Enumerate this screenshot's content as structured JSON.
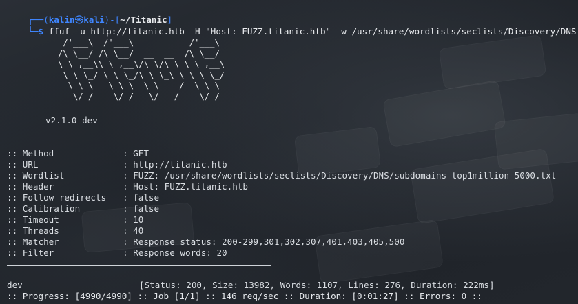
{
  "prompt": {
    "open": "┌──(",
    "user": "kalin",
    "at": "㉿",
    "host": "kali",
    "mid": ")-[",
    "path": "~/Titanic",
    "close": "]",
    "second_prefix": "└─",
    "dollar": "$",
    "command": "ffuf -u http://titanic.htb -H \"Host: FUZZ.titanic.htb\" -w /usr/share/wordlists/seclists/Discovery/DNS"
  },
  "banner": {
    "art": "    /'___\\  /'___\\           /'___\\\n   /\\ \\__/ /\\ \\__/  __  __  /\\ \\__/\n   \\ \\ ,__\\\\ \\ ,__\\/\\ \\/\\ \\ \\ \\ ,__\\\n    \\ \\ \\_/ \\ \\ \\_/\\ \\ \\_\\ \\ \\ \\ \\_/\n     \\ \\_\\   \\ \\_\\  \\ \\____/  \\ \\_\\\n      \\/_/    \\/_/   \\/___/    \\/_/",
    "version": "v2.1.0-dev"
  },
  "config": [
    {
      "key": ":: Method",
      "value": ": GET"
    },
    {
      "key": ":: URL",
      "value": ": http://titanic.htb"
    },
    {
      "key": ":: Wordlist",
      "value": ": FUZZ: /usr/share/wordlists/seclists/Discovery/DNS/subdomains-top1million-5000.txt"
    },
    {
      "key": ":: Header",
      "value": ": Host: FUZZ.titanic.htb"
    },
    {
      "key": ":: Follow redirects",
      "value": ": false"
    },
    {
      "key": ":: Calibration",
      "value": ": false"
    },
    {
      "key": ":: Timeout",
      "value": ": 10"
    },
    {
      "key": ":: Threads",
      "value": ": 40"
    },
    {
      "key": ":: Matcher",
      "value": ": Response status: 200-299,301,302,307,401,403,405,500"
    },
    {
      "key": ":: Filter",
      "value": ": Response words: 20"
    }
  ],
  "result": {
    "word": "dev",
    "details": "[Status: 200, Size: 13982, Words: 1107, Lines: 276, Duration: 222ms]"
  },
  "progress_line": ":: Progress: [4990/4990] :: Job [1/1] :: 146 req/sec :: Duration: [0:01:27] :: Errors: 0 ::"
}
